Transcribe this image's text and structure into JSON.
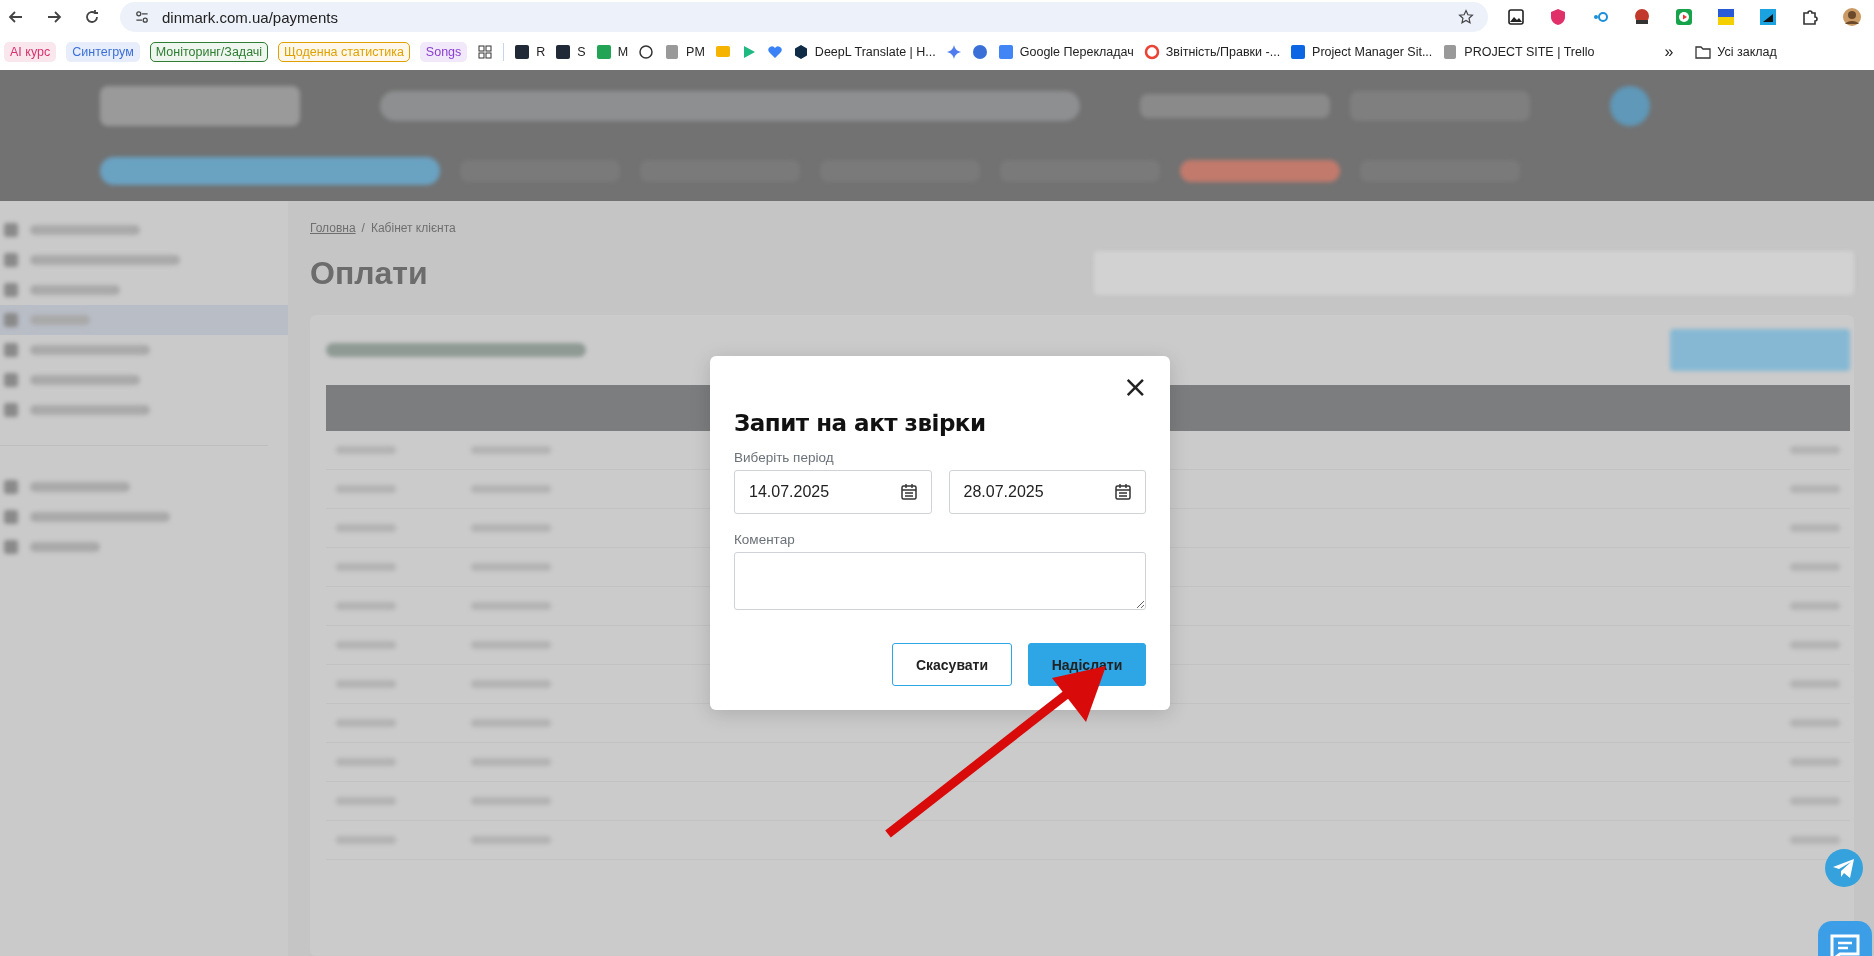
{
  "browser": {
    "url": "dinmark.com.ua/payments",
    "bookmarks": [
      {
        "kind": "chip",
        "label": "AI курс",
        "color": "#d6336c"
      },
      {
        "kind": "chip",
        "label": "Синтегрум",
        "color": "#3b6fd8"
      },
      {
        "kind": "outline",
        "label": "Моніторинг/Задачі",
        "color": "#2e7d32"
      },
      {
        "kind": "outline",
        "label": "Щоденна статистика",
        "color": "#e0a000"
      },
      {
        "kind": "chip",
        "label": "Songs",
        "color": "#8a3fd1"
      },
      {
        "kind": "apps"
      },
      {
        "kind": "sep"
      },
      {
        "kind": "link",
        "label": "R"
      },
      {
        "kind": "link",
        "label": "S"
      },
      {
        "kind": "link",
        "label": "M"
      },
      {
        "kind": "icon"
      },
      {
        "kind": "link",
        "label": "PM"
      },
      {
        "kind": "icon"
      },
      {
        "kind": "icon"
      },
      {
        "kind": "icon"
      },
      {
        "kind": "link",
        "label": "DeepL Translate | Н..."
      },
      {
        "kind": "icon"
      },
      {
        "kind": "icon"
      },
      {
        "kind": "link",
        "label": "Google Перекладач"
      },
      {
        "kind": "link",
        "label": "Звітність/Правки -..."
      },
      {
        "kind": "link",
        "label": "Project Manager Sit..."
      },
      {
        "kind": "link",
        "label": "PROJECT SITE | Trello"
      },
      {
        "kind": "more",
        "label": "»"
      },
      {
        "kind": "folder",
        "label": "Усі заклад"
      }
    ]
  },
  "breadcrumb": [
    {
      "label": "Головна",
      "link": true
    },
    {
      "label": "Кабінет клієнта",
      "link": false
    }
  ],
  "breadcrumb_separator": "/",
  "page_title": "Оплати",
  "dialog": {
    "title": "Запит на акт звірки",
    "close": "×",
    "period_label": "Виберіть період",
    "date_from": "14.07.2025",
    "date_to": "28.07.2025",
    "comment_label": "Коментар",
    "cancel": "Скасувати",
    "submit": "Надіслати"
  }
}
